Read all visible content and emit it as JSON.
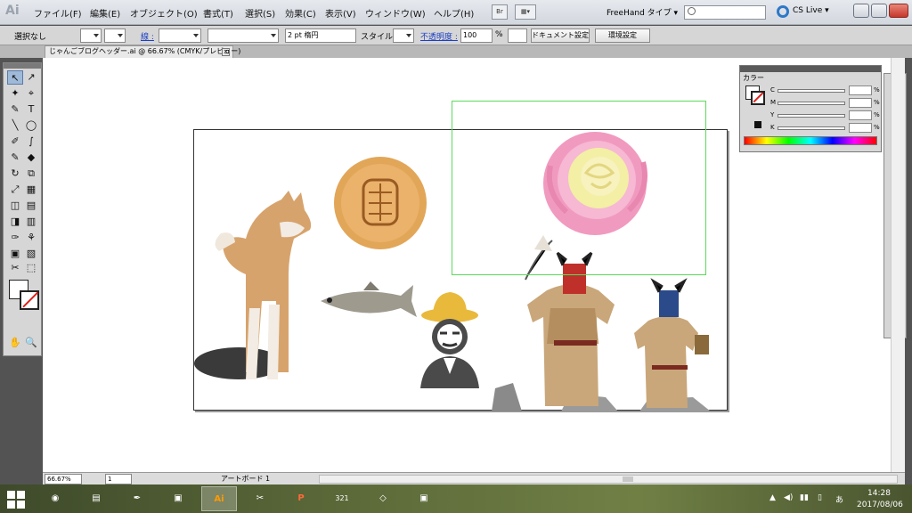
{
  "menubar": {
    "app_logo": "Ai",
    "items": [
      "ファイル(F)",
      "編集(E)",
      "オブジェクト(O)",
      "書式(T)",
      "選択(S)",
      "効果(C)",
      "表示(V)",
      "ウィンドウ(W)",
      "ヘルプ(H)"
    ],
    "bridge_label": "Br",
    "workspace": "FreeHand タイプ ▾",
    "cslive": "CS Live ▾"
  },
  "controlbar": {
    "selection": "選択なし",
    "stroke_link": "線 :",
    "stroke_width": "2 pt 楕円",
    "style_label": "スタイル :",
    "opacity_link": "不透明度 :",
    "opacity_value": "100",
    "opacity_unit": "%",
    "doc_setup": "ドキュメント設定",
    "preferences": "環境設定"
  },
  "document_tab": {
    "title": "じゃんごブログヘッダー.ai @ 66.67% (CMYK/プレビュー)",
    "close": "×"
  },
  "tools": [
    "↖",
    "↗",
    "✦",
    "⌖",
    "✎",
    "T",
    "╲",
    "◯",
    "✐",
    "∫",
    "✎",
    "◆",
    "↻",
    "⧉",
    "⤢",
    "▦",
    "◫",
    "▤",
    "◨",
    "▥",
    "✑",
    "⚘",
    "▣",
    "▧",
    "✂",
    "⬚",
    "✋",
    "🔍"
  ],
  "status": {
    "zoom": "66.67%",
    "page": "1",
    "artboard_name": "アートボード 1"
  },
  "color_panel": {
    "tab": "カラー",
    "channels": [
      "C",
      "M",
      "Y",
      "K"
    ],
    "pct": "%"
  },
  "dock": [
    "≡",
    "▭",
    "◉",
    "✺",
    "♨",
    "A",
    "▦",
    "◈",
    "⧉",
    "♣",
    "◎"
  ],
  "taskbar": {
    "apps": [
      "◉",
      "▤",
      "✒",
      "▣",
      "Ai",
      "✂",
      "P",
      "321",
      "◇",
      "▣"
    ],
    "tray": [
      "▲",
      "◀)",
      "▮▮",
      "▯",
      "あ"
    ],
    "time": "14:28",
    "date": "2017/08/06"
  },
  "colors": {
    "accent_link": "#1b3fc6",
    "selection_green": "#5bdb5b",
    "none_red": "#e0201a"
  }
}
